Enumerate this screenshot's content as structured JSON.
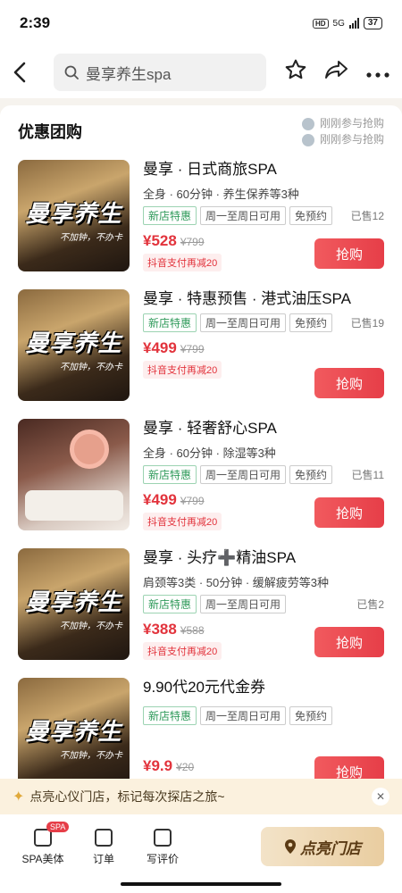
{
  "status": {
    "time": "2:39",
    "hd": "HD",
    "net": "5G",
    "battery": "37"
  },
  "nav": {
    "back_icon": "back-arrow-icon",
    "search_query": "曼享养生spa"
  },
  "section": {
    "title": "优惠团购",
    "ticker": [
      "刚刚参与抢购",
      "刚刚参与抢购"
    ]
  },
  "deals": [
    {
      "title": "曼享 · 日式商旅SPA",
      "desc": "全身 · 60分钟 · 养生保养等3种",
      "tag_new": "新店特惠",
      "tag_days": "周一至周日可用",
      "tag_book": "免预约",
      "sold": "已售12",
      "price": "¥528",
      "orig": "¥799",
      "coupon": "抖音支付再减20",
      "buy": "抢购",
      "banner": "曼享养生",
      "banner_sub": "不加钟，不办卡"
    },
    {
      "title": "曼享 · 特惠预售 · 港式油压SPA",
      "desc": "",
      "tag_new": "新店特惠",
      "tag_days": "周一至周日可用",
      "tag_book": "免预约",
      "sold": "已售19",
      "price": "¥499",
      "orig": "¥799",
      "coupon": "抖音支付再减20",
      "buy": "抢购",
      "banner": "曼享养生",
      "banner_sub": "不加钟，不办卡"
    },
    {
      "title": "曼享 · 轻奢舒心SPA",
      "desc": "全身 · 60分钟 · 除湿等3种",
      "tag_new": "新店特惠",
      "tag_days": "周一至周日可用",
      "tag_book": "免预约",
      "sold": "已售11",
      "price": "¥499",
      "orig": "¥799",
      "coupon": "抖音支付再减20",
      "buy": "抢购",
      "banner": "",
      "banner_sub": ""
    },
    {
      "title": "曼享 · 头疗➕精油SPA",
      "desc": "肩颈等3类 · 50分钟 · 缓解疲劳等3种",
      "tag_new": "新店特惠",
      "tag_days": "周一至周日可用",
      "tag_book": "",
      "sold": "已售2",
      "price": "¥388",
      "orig": "¥588",
      "coupon": "抖音支付再减20",
      "buy": "抢购",
      "banner": "曼享养生",
      "banner_sub": "不加钟，不办卡"
    },
    {
      "title": "9.90代20元代金券",
      "desc": "",
      "tag_new": "新店特惠",
      "tag_days": "周一至周日可用",
      "tag_book": "免预约",
      "sold": "",
      "price": "¥9.9",
      "orig": "¥20",
      "coupon": "",
      "buy": "抢购",
      "banner": "曼享养生",
      "banner_sub": "不加钟，不办卡"
    }
  ],
  "toast": {
    "text": "点亮心仪门店，标记每次探店之旅~"
  },
  "tabbar": {
    "spa": "SPA美体",
    "spa_badge": "SPA",
    "orders": "订单",
    "review": "写评价",
    "cta": "点亮门店"
  },
  "colors": {
    "accent": "#e63e48",
    "price": "#e2333c",
    "tag_green": "#2f9a5a",
    "cta_bg": "#e9cda0"
  }
}
